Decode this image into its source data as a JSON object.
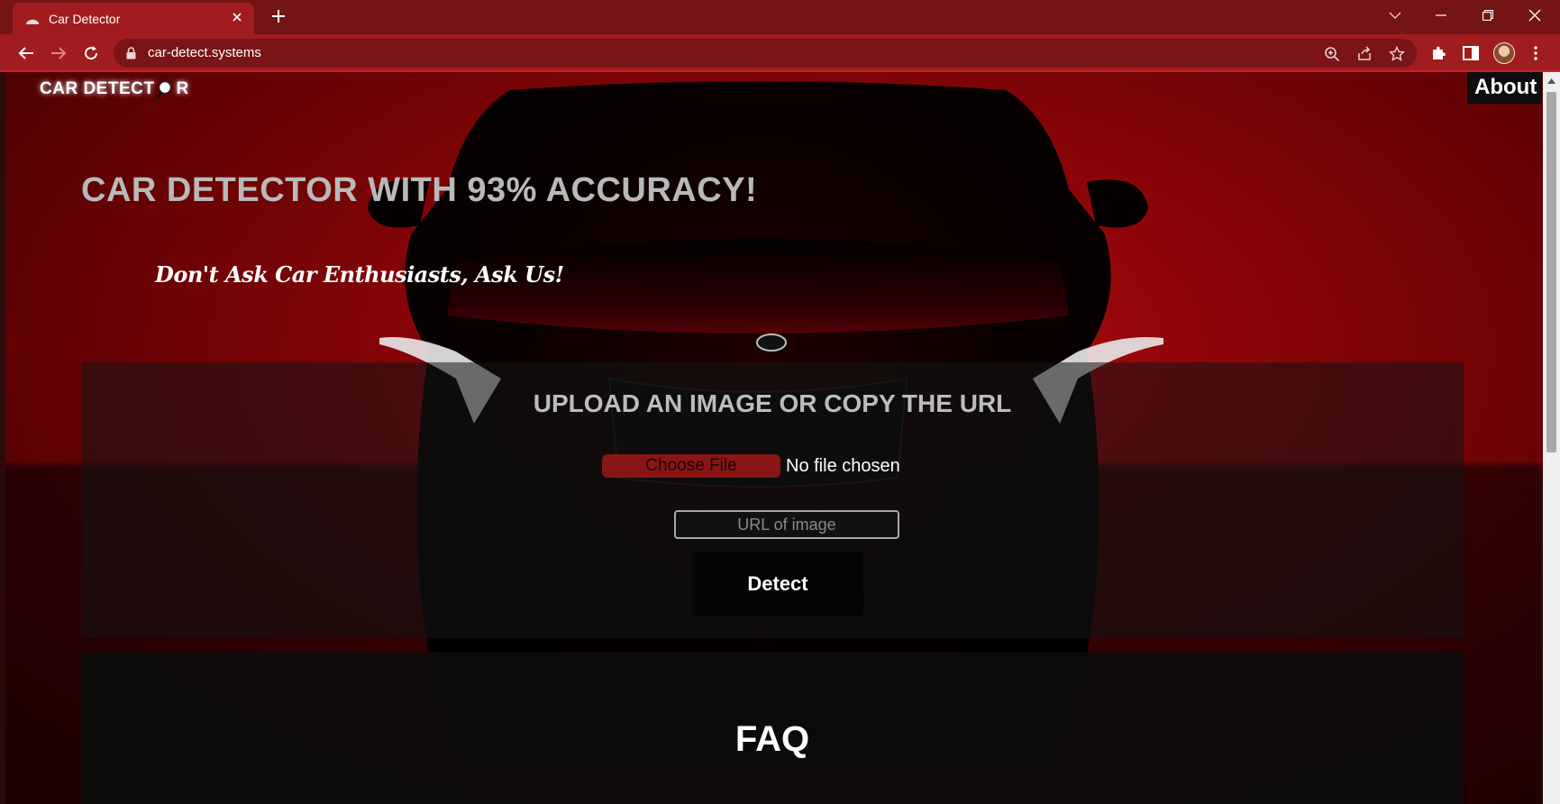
{
  "browser": {
    "tab_title": "Car Detector",
    "url": "car-detect.systems"
  },
  "colors": {
    "chrome_tabbar": "#741415",
    "chrome_toolbar": "#a11c1e",
    "page_red": "#9c0508",
    "choose_button": "#8a1515"
  },
  "icons": [
    "car-favicon-icon",
    "close-icon",
    "plus-icon",
    "chevron-down-icon",
    "minimize-icon",
    "restore-icon",
    "close-window-icon",
    "back-arrow-icon",
    "forward-arrow-icon",
    "reload-icon",
    "lock-icon",
    "zoom-icon",
    "share-icon",
    "star-icon",
    "puzzle-icon",
    "side-panel-icon",
    "kebab-menu-icon",
    "magnifier-icon"
  ],
  "header": {
    "logo_pre": "CAR DETECT",
    "logo_post": "R",
    "about_label": "About"
  },
  "hero": {
    "title": "CAR DETECTOR WITH 93% ACCURACY!",
    "tagline": "Don't Ask Car Enthusiasts, Ask Us!"
  },
  "upload": {
    "title": "UPLOAD AN IMAGE OR COPY THE URL",
    "choose_label": "Choose File",
    "no_file_label": "No file chosen",
    "url_placeholder": "URL of image",
    "detect_label": "Detect"
  },
  "faq": {
    "title": "FAQ"
  }
}
